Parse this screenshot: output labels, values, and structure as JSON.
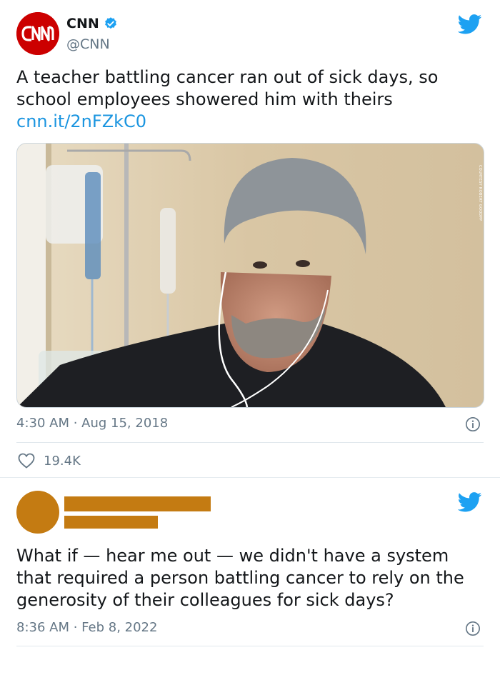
{
  "tweet1": {
    "display_name": "CNN",
    "handle": "@CNN",
    "avatar_logo_text": "CNN",
    "text": "A teacher battling cancer ran out of sick days, so school employees showered him with theirs",
    "link": "cnn.it/2nFZkC0",
    "photo_credit": "COURTESY ROBERT GOODPP",
    "timestamp": "4:30 AM · Aug 15, 2018",
    "likes": "19.4K"
  },
  "tweet2": {
    "text": "What if — hear me out — we didn't have a system that required a person battling cancer to rely on the generosity of their colleagues for sick days?",
    "timestamp": "8:36 AM · Feb 8, 2022"
  },
  "icons": {
    "brand": "twitter-bird-icon",
    "verified": "verified-badge-icon",
    "info": "info-icon",
    "like": "heart-icon"
  },
  "colors": {
    "twitter_blue": "#1da1f2",
    "link_blue": "#1b95e0",
    "cnn_red": "#cc0000",
    "redaction": "#c47b12",
    "secondary_text": "#657786"
  }
}
